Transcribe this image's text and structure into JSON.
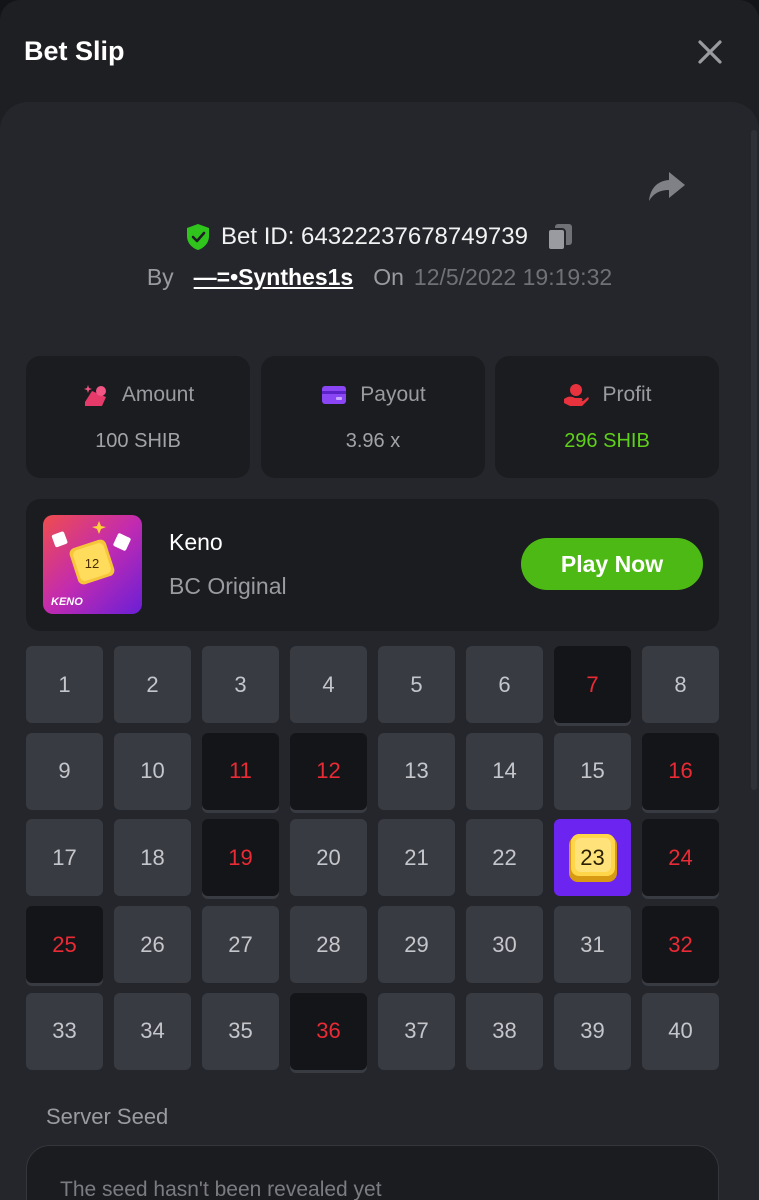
{
  "header": {
    "title": "Bet Slip"
  },
  "bet": {
    "id_text": "Bet ID: 64322237678749739",
    "by_label": "By",
    "user": "—=•Synthes1s",
    "on_label": "On",
    "date": "12/5/2022 19:19:32"
  },
  "stats": [
    {
      "label": "Amount",
      "value": "100 SHIB",
      "icon": "coins-icon"
    },
    {
      "label": "Payout",
      "value": "3.96 x",
      "icon": "card-icon"
    },
    {
      "label": "Profit",
      "value": "296 SHIB",
      "icon": "hand-profit-icon"
    }
  ],
  "game": {
    "name": "Keno",
    "subtitle": "BC Original",
    "play_label": "Play Now",
    "thumb_text": "KENO",
    "thumb_die": "12"
  },
  "keno": {
    "numbers": [
      "1",
      "2",
      "3",
      "4",
      "5",
      "6",
      "7",
      "8",
      "9",
      "10",
      "11",
      "12",
      "13",
      "14",
      "15",
      "16",
      "17",
      "18",
      "19",
      "20",
      "21",
      "22",
      "23",
      "24",
      "25",
      "26",
      "27",
      "28",
      "29",
      "30",
      "31",
      "32",
      "33",
      "34",
      "35",
      "36",
      "37",
      "38",
      "39",
      "40"
    ],
    "missed": [
      7,
      11,
      12,
      16,
      19,
      24,
      25,
      32,
      36
    ],
    "hits": [
      23
    ]
  },
  "seed": {
    "label": "Server Seed",
    "text": "The seed hasn't been revealed yet"
  },
  "colors": {
    "accent_green": "#4cb915",
    "profit_green": "#5ed11a",
    "miss_red": "#ea2a35",
    "hit_purple": "#6c24f0"
  }
}
